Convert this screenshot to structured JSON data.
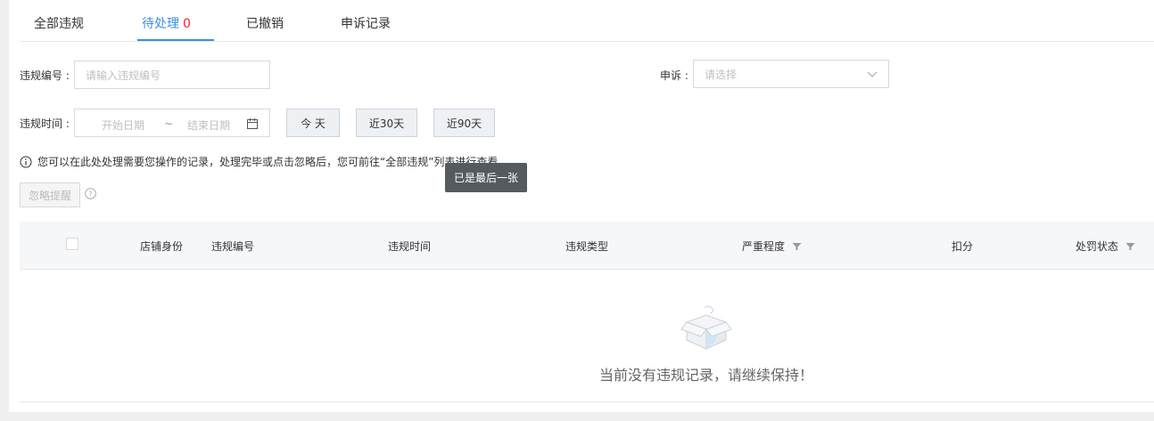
{
  "tabs": [
    {
      "label": "全部违规",
      "count": ""
    },
    {
      "label": "待处理",
      "count": "0"
    },
    {
      "label": "已撤销",
      "count": ""
    },
    {
      "label": "申诉记录",
      "count": ""
    }
  ],
  "filters": {
    "violation_id_label": "违规编号 :",
    "violation_id_placeholder": "请输入违规编号",
    "appeal_label": "申诉 :",
    "appeal_placeholder": "请选择",
    "time_label": "违规时间 :",
    "start_placeholder": "开始日期",
    "range_sep": "~",
    "end_placeholder": "结束日期",
    "quick_buttons": [
      "今 天",
      "近30天",
      "近90天"
    ]
  },
  "notice": "您可以在此处处理需要您操作的记录，处理完毕或点击忽略后，您可前往“全部违规”列表进行查看。",
  "ignore_button": "忽略提醒",
  "tooltip": "已是最后一张",
  "table": {
    "columns": [
      "店铺身份",
      "违规编号",
      "违规时间",
      "违规类型",
      "严重程度",
      "扣分",
      "处罚状态"
    ]
  },
  "empty_text": "当前没有违规记录，请继续保持！",
  "colors": {
    "accent": "#3a8ee6",
    "count": "#f5222d"
  }
}
